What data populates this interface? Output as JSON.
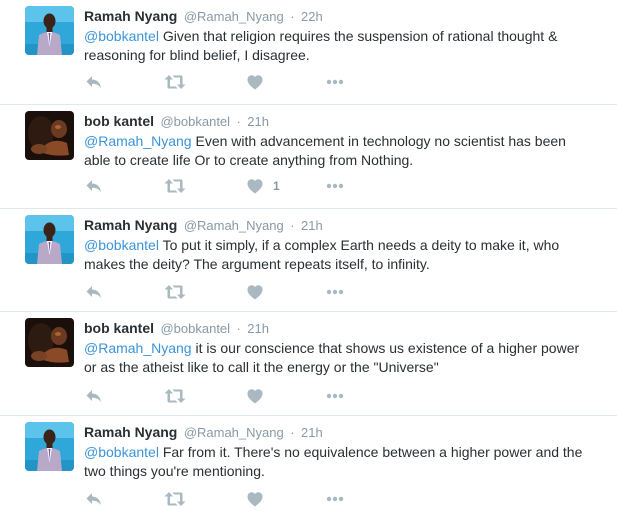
{
  "tweets": [
    {
      "fullname": "Ramah Nyang",
      "username": "@Ramah_Nyang",
      "separator": "·",
      "time": "22h",
      "mention": "@bobkantel",
      "text": " Given that religion requires the suspension of rational thought & reasoning for blind belief, I disagree.",
      "like_count": ""
    },
    {
      "fullname": "bob kantel",
      "username": "@bobkantel",
      "separator": "·",
      "time": "21h",
      "mention": "@Ramah_Nyang",
      "text": " Even with advancement in technology no scientist has been able to create life Or to create anything from Nothing.",
      "like_count": "1"
    },
    {
      "fullname": "Ramah Nyang",
      "username": "@Ramah_Nyang",
      "separator": "·",
      "time": "21h",
      "mention": "@bobkantel",
      "text": " To put it simply, if a complex Earth needs a deity to make it, who makes the deity? The argument repeats itself, to infinity.",
      "like_count": ""
    },
    {
      "fullname": "bob kantel",
      "username": "@bobkantel",
      "separator": "·",
      "time": "21h",
      "mention": "@Ramah_Nyang",
      "text": " it is our conscience that shows us existence of a higher power or as the atheist like to call it the energy or the \"Universe\"",
      "like_count": ""
    },
    {
      "fullname": "Ramah Nyang",
      "username": "@Ramah_Nyang",
      "separator": "·",
      "time": "21h",
      "mention": "@bobkantel",
      "text": " Far from it. There's no equivalence between a higher power and the two things you're mentioning.",
      "like_count": ""
    }
  ],
  "icons": {
    "reply": "reply-icon",
    "retweet": "retweet-icon",
    "like": "heart-icon",
    "more": "more-icon"
  },
  "colors": {
    "link": "#3b94d9",
    "secondary_text": "#8899a6",
    "primary_text": "#292f33",
    "icon": "#aab8c2",
    "divider": "#e1e8ed"
  }
}
